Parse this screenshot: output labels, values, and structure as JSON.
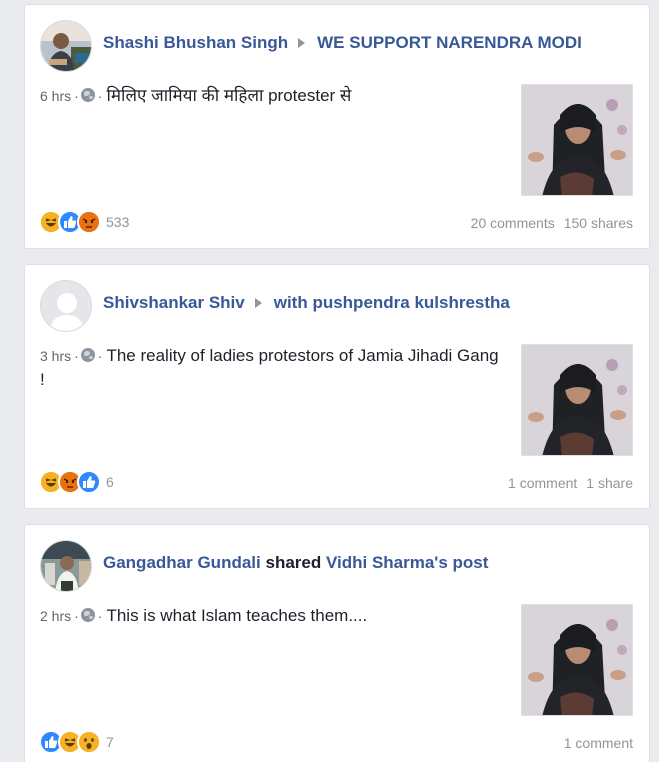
{
  "posts": [
    {
      "author": "Shashi Bhushan Singh",
      "connector": "",
      "target": "WE SUPPORT NARENDRA MODI",
      "time": "6 hrs",
      "text": "मिलिए जामिया की महिला protester से",
      "reactions": [
        "haha",
        "like",
        "angry"
      ],
      "reaction_count": "533",
      "comments": "20 comments",
      "shares": "150 shares"
    },
    {
      "author": "Shivshankar Shiv",
      "connector": "",
      "target": "with pushpendra kulshrestha",
      "time": "3 hrs",
      "text": "The reality of ladies protestors of Jamia Jihadi Gang !",
      "reactions": [
        "haha",
        "angry",
        "like"
      ],
      "reaction_count": "6",
      "comments": "1 comment",
      "shares": "1 share"
    },
    {
      "author": "Gangadhar Gundali",
      "connector": "shared",
      "target": "Vidhi Sharma's post",
      "time": "2 hrs",
      "text": "This is what Islam teaches them....",
      "reactions": [
        "like",
        "haha",
        "wow"
      ],
      "reaction_count": "7",
      "comments": "1 comment",
      "shares": ""
    }
  ],
  "icons": {
    "privacy": "globe-icon",
    "arrow": "triangle-right-icon"
  },
  "colors": {
    "link": "#385898",
    "background": "#e9ebee",
    "like": "#2e89ff",
    "haha": "#f7b125",
    "angry": "#e9710f"
  }
}
